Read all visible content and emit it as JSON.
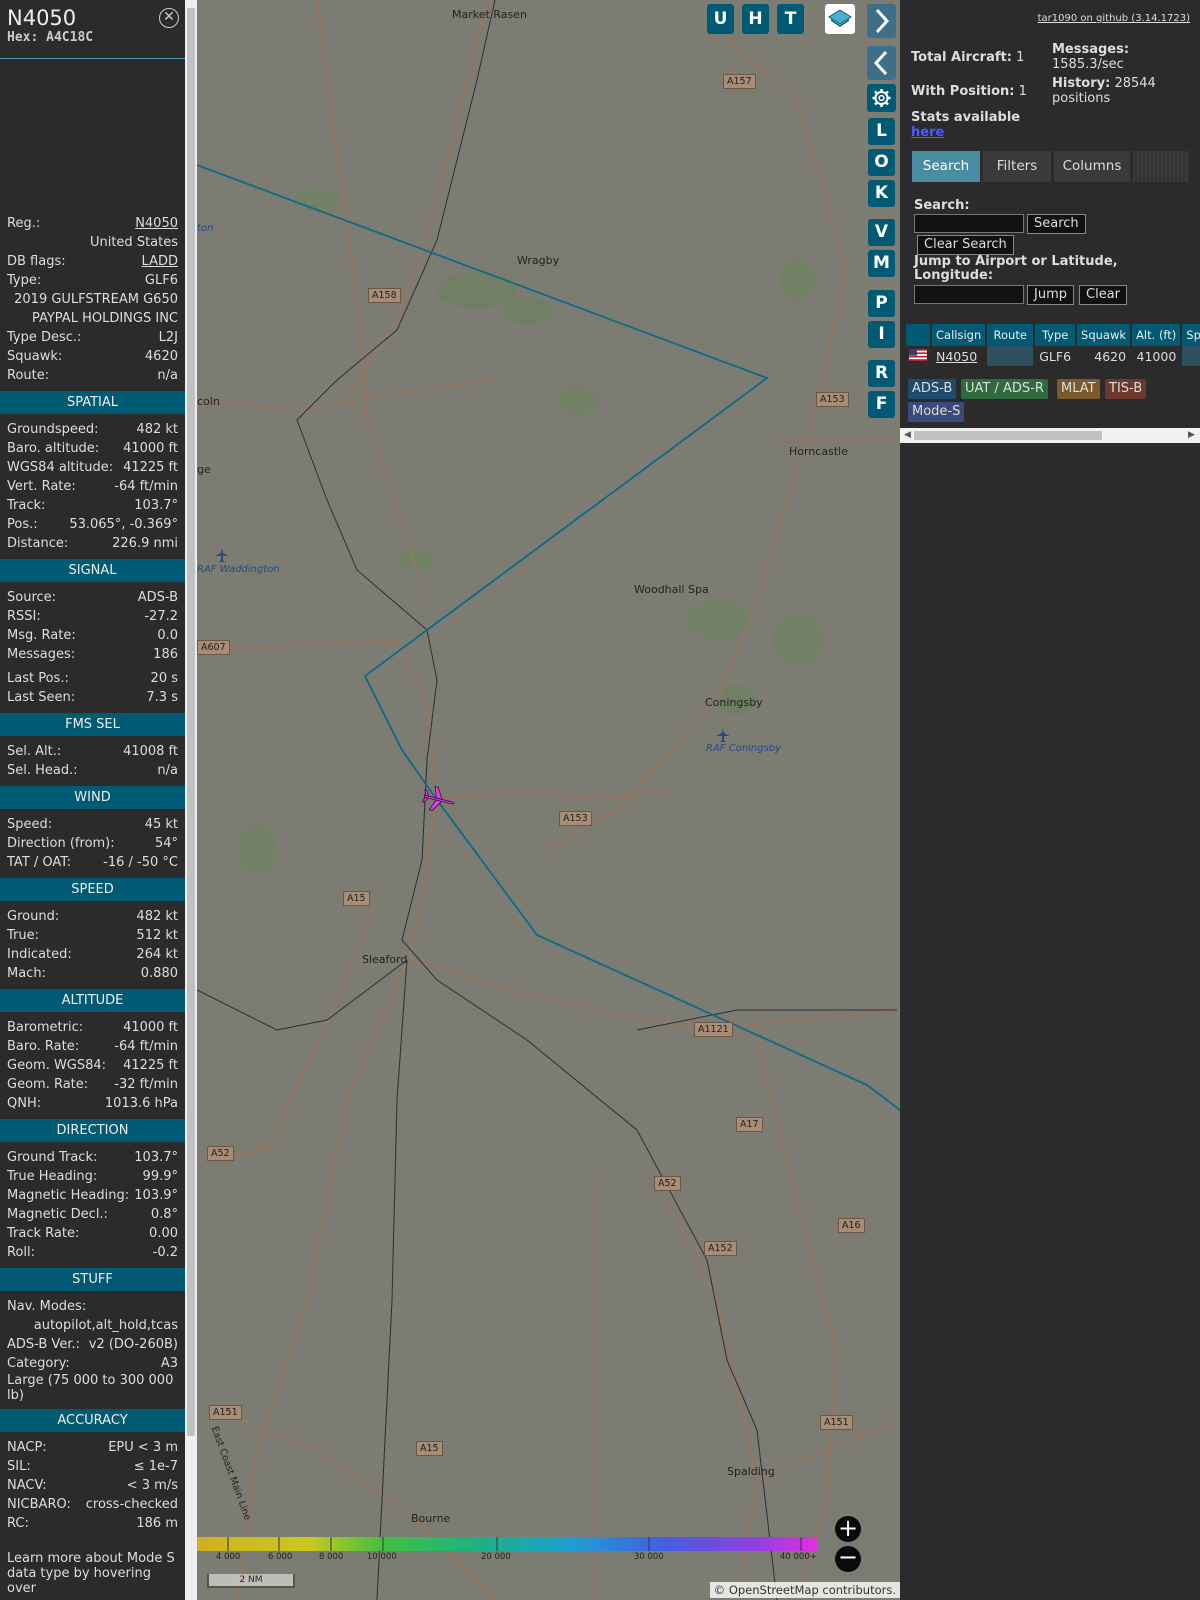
{
  "aircraft": {
    "callsign": "N4050",
    "hex_label": "Hex: A4C18C",
    "close_icon": "close-icon",
    "basic": [
      {
        "k": "Reg.:",
        "v": "N4050",
        "link": true
      },
      {
        "k": "",
        "v": "United States"
      },
      {
        "k": "DB flags:",
        "v": "LADD",
        "link": true
      },
      {
        "k": "Type:",
        "v": "GLF6"
      },
      {
        "k": "",
        "v": "2019 GULFSTREAM G650"
      },
      {
        "k": "",
        "v": "PAYPAL HOLDINGS INC"
      },
      {
        "k": "Type Desc.:",
        "v": "L2J"
      },
      {
        "k": "Squawk:",
        "v": "4620"
      },
      {
        "k": "Route:",
        "v": "n/a"
      }
    ],
    "sections": [
      {
        "title": "SPATIAL",
        "rows": [
          {
            "k": "Groundspeed:",
            "v": "482 kt"
          },
          {
            "k": "Baro. altitude:",
            "v": "41000 ft"
          },
          {
            "k": "WGS84 altitude:",
            "v": "41225 ft"
          },
          {
            "k": "Vert. Rate:",
            "v": "-64 ft/min"
          },
          {
            "k": "Track:",
            "v": "103.7°"
          },
          {
            "k": "Pos.:",
            "v": "53.065°, -0.369°"
          },
          {
            "k": "Distance:",
            "v": "226.9 nmi"
          }
        ]
      },
      {
        "title": "SIGNAL",
        "rows": [
          {
            "k": "Source:",
            "v": "ADS-B"
          },
          {
            "k": "RSSI:",
            "v": "-27.2"
          },
          {
            "k": "Msg. Rate:",
            "v": "0.0"
          },
          {
            "k": "Messages:",
            "v": "186"
          },
          {
            "gap": true
          },
          {
            "k": "Last Pos.:",
            "v": "20 s"
          },
          {
            "k": "Last Seen:",
            "v": "7.3 s"
          }
        ]
      },
      {
        "title": "FMS SEL",
        "rows": [
          {
            "k": "Sel. Alt.:",
            "v": "41008 ft"
          },
          {
            "k": "Sel. Head.:",
            "v": "n/a"
          }
        ]
      },
      {
        "title": "WIND",
        "rows": [
          {
            "k": "Speed:",
            "v": "45 kt"
          },
          {
            "k": "Direction (from):",
            "v": "54°"
          },
          {
            "k": "TAT / OAT:",
            "v": "-16 / -50 °C"
          }
        ]
      },
      {
        "title": "SPEED",
        "rows": [
          {
            "k": "Ground:",
            "v": "482 kt"
          },
          {
            "k": "True:",
            "v": "512 kt"
          },
          {
            "k": "Indicated:",
            "v": "264 kt"
          },
          {
            "k": "Mach:",
            "v": "0.880"
          }
        ]
      },
      {
        "title": "ALTITUDE",
        "rows": [
          {
            "k": "Barometric:",
            "v": "41000 ft"
          },
          {
            "k": "Baro. Rate:",
            "v": "-64 ft/min"
          },
          {
            "k": "Geom. WGS84:",
            "v": "41225 ft"
          },
          {
            "k": "Geom. Rate:",
            "v": "-32 ft/min"
          },
          {
            "k": "QNH:",
            "v": "1013.6 hPa"
          }
        ]
      },
      {
        "title": "DIRECTION",
        "rows": [
          {
            "k": "Ground Track:",
            "v": "103.7°"
          },
          {
            "k": "True Heading:",
            "v": "99.9°"
          },
          {
            "k": "Magnetic Heading:",
            "v": "103.9°"
          },
          {
            "k": "Magnetic Decl.:",
            "v": "0.8°"
          },
          {
            "k": "Track Rate:",
            "v": "0.00"
          },
          {
            "k": "Roll:",
            "v": "-0.2"
          }
        ]
      },
      {
        "title": "STUFF",
        "rows": [
          {
            "k": "Nav. Modes:",
            "v": ""
          },
          {
            "k": "",
            "v": "autopilot,alt_hold,tcas"
          },
          {
            "k": "ADS-B Ver.:",
            "v": "v2 (DO-260B)"
          },
          {
            "k": "Category:",
            "v": "A3"
          },
          {
            "wrap": "Large (75 000 to 300 000 lb)"
          }
        ]
      },
      {
        "title": "ACCURACY",
        "rows": [
          {
            "k": "NACP:",
            "v": "EPU < 3 m"
          },
          {
            "k": "SIL:",
            "v": "≤ 1e-7"
          },
          {
            "k": "NACV:",
            "v": "< 3 m/s"
          },
          {
            "k": "NICBARO:",
            "v": "cross-checked"
          },
          {
            "k": "RC:",
            "v": "186 m"
          }
        ]
      }
    ],
    "footer_note": "Learn more about Mode S data type by hovering over"
  },
  "map": {
    "places": [
      "Market Rasen",
      "Wragby",
      "Horncastle",
      "Woodhall Spa",
      "Coningsby",
      "RAF Coningsby",
      "RAF Waddington",
      "Sleaford",
      "Spalding",
      "Bourne",
      "coln",
      "ge",
      "ton"
    ],
    "roads": [
      "A157",
      "A158",
      "A153",
      "A607",
      "A153",
      "A15",
      "A1121",
      "A17",
      "A52",
      "A52",
      "A16",
      "A152",
      "A151",
      "A151",
      "A15"
    ],
    "rail_label": "East Coast Main Line",
    "buttons": [
      "U",
      "H",
      "T",
      "L",
      "O",
      "K",
      "V",
      "M",
      "P",
      "I",
      "R",
      "F"
    ],
    "altitude_scale": [
      "4 000",
      "6 000",
      "8 000",
      "10 000",
      "20 000",
      "30 000",
      "40 000+"
    ],
    "scale_label": "2 NM",
    "attribution_prefix": "© ",
    "attribution_link": "OpenStreetMap",
    "attribution_suffix": " contributors.",
    "zoom_in": "+",
    "zoom_out": "−",
    "aircraft_color": "#e23ee0",
    "track_color": "#0b6b8a"
  },
  "panel": {
    "github_link": "tar1090 on github (3.14.1723)",
    "total_aircraft_label": "Total Aircraft:",
    "total_aircraft": "1",
    "with_position_label": "With Position:",
    "with_position": "1",
    "messages_label": "Messages:",
    "messages_rate": "1585.3/sec",
    "history_label": "History:",
    "history_value": "28544 positions",
    "stats_label": "Stats available",
    "stats_link": "here",
    "tabs": [
      "Search",
      "Filters",
      "Columns"
    ],
    "search_label": "Search:",
    "search_button": "Search",
    "clear_search_button": "Clear Search",
    "jump_label": "Jump to Airport or Latitude, Longitude:",
    "jump_button": "Jump",
    "clear_button": "Clear",
    "table_headers": [
      "",
      "Callsign",
      "Route",
      "Type",
      "Squawk",
      "Alt. (ft)",
      "Spd."
    ],
    "table_rows": [
      {
        "callsign": "N4050",
        "route": "",
        "type": "GLF6",
        "squawk": "4620",
        "alt": "41000",
        "spd": ""
      }
    ],
    "badges": [
      {
        "label": "ADS-B",
        "color": "#1e4a6b"
      },
      {
        "label": "UAT / ADS-R",
        "color": "#2f6b3c"
      },
      {
        "label": "MLAT",
        "color": "#7a5a2c"
      },
      {
        "label": "TIS-B",
        "color": "#6b3a2c"
      },
      {
        "label": "Mode-S",
        "color": "#3a4a7a"
      }
    ]
  }
}
